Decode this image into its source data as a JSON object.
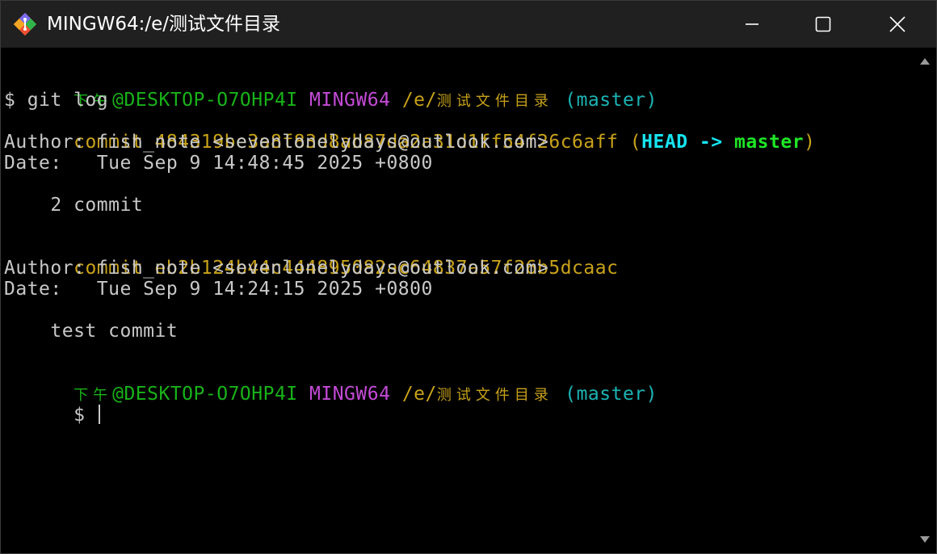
{
  "window": {
    "title": "MINGW64:/e/测试文件目录",
    "controls": {
      "minimize_icon": "minimize-icon",
      "maximize_icon": "maximize-icon",
      "close_icon": "close-icon"
    },
    "app_icon": "git-icon"
  },
  "terminal": {
    "prompt1": {
      "time": "下午",
      "host": "@DESKTOP-O7OHP4I",
      "shell": "MINGW64",
      "path_prefix": "/e/",
      "path_cjk": "测试文件目录",
      "branch": "(master)"
    },
    "command_line": "$ git log",
    "commits": [
      {
        "commit_label": "commit",
        "hash": "484319be3a8f83d8ab87da2a31d1ff54f26c6aff",
        "refs_open": "(",
        "head": "HEAD",
        "arrow": "->",
        "branch": "master",
        "refs_close": ")",
        "author_line": "Author: fish_note <sevenlonelydays@outlook.com>",
        "date_line": "Date:   Tue Sep 9 14:48:45 2025 +0800",
        "message": "    2 commit"
      },
      {
        "commit_label": "commit",
        "hash": "eb2b124b44c444895082ac64837a57f26b5dcaac",
        "author_line": "Author: fish_note <sevenlonelydays@outlook.com>",
        "date_line": "Date:   Tue Sep 9 14:24:15 2025 +0800",
        "message": "    test commit"
      }
    ],
    "prompt2": {
      "time": "下午",
      "host": "@DESKTOP-O7OHP4I",
      "shell": "MINGW64",
      "path_prefix": "/e/",
      "path_cjk": "测试文件目录",
      "branch": "(master)"
    },
    "final_prompt": "$ "
  },
  "colors": {
    "green": "#18b218",
    "magenta": "#c34bd6",
    "yellow": "#c8a21a",
    "cyan": "#1cb4b4",
    "head": "#17e3f0",
    "branch_bold": "#1fe626"
  }
}
